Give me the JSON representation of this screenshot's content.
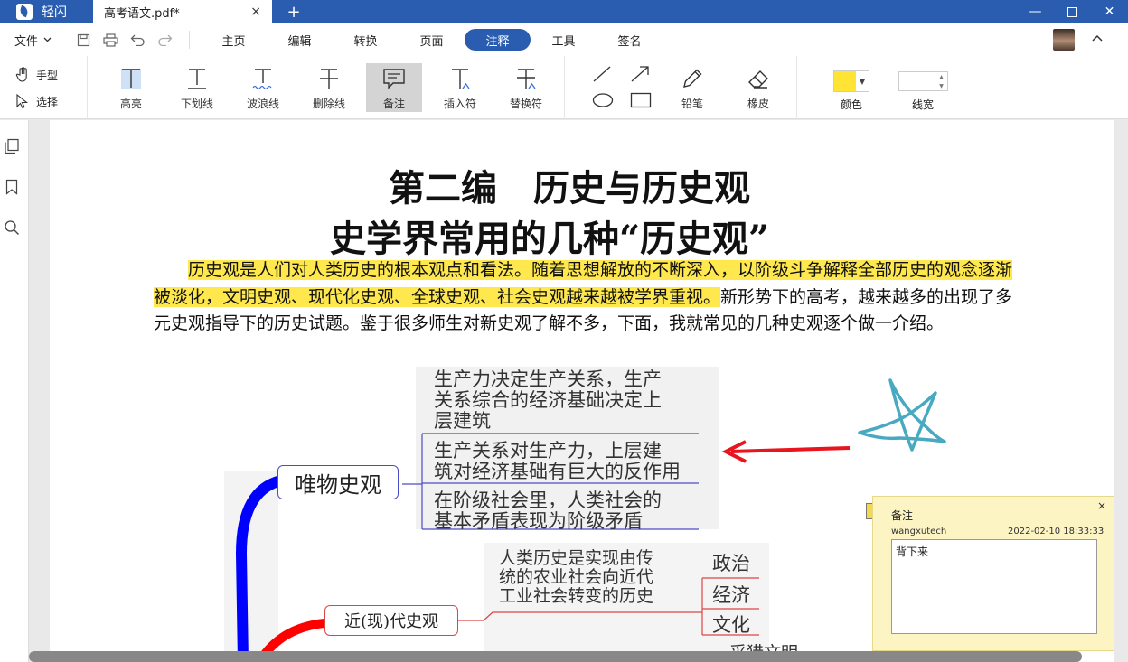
{
  "app": {
    "name": "轻闪",
    "doc_tab": "高考语文.pdf*",
    "tab_close": "×",
    "new_tab": "+"
  },
  "window": {
    "minimize": "—",
    "close": "✕"
  },
  "menu": {
    "file_label": "文件",
    "tabs": [
      {
        "label": "主页"
      },
      {
        "label": "编辑"
      },
      {
        "label": "转换"
      },
      {
        "label": "页面"
      },
      {
        "label": "注释",
        "active": true
      },
      {
        "label": "工具"
      },
      {
        "label": "签名"
      }
    ]
  },
  "toolbar": {
    "hand": "手型",
    "select": "选择",
    "tools": [
      {
        "label": "高亮"
      },
      {
        "label": "下划线"
      },
      {
        "label": "波浪线"
      },
      {
        "label": "删除线"
      },
      {
        "label": "备注",
        "selected": true
      },
      {
        "label": "插入符"
      },
      {
        "label": "替换符"
      }
    ],
    "pencil": "铅笔",
    "eraser": "橡皮",
    "color_label": "颜色",
    "color_value": "#ffe436",
    "line_width_label": "线宽"
  },
  "document": {
    "heading1": "第二编　历史与历史观",
    "heading2": "史学界常用的几种“历史观”",
    "para_highlighted": "历史观是人们对人类历史的根本观点和看法。随着思想解放的不断深入，以阶级斗争解释全部历史的观念逐渐被淡化，文明史观、现代化史观、全球史观、社会史观越来越被学界重视。",
    "para_rest": "新形势下的高考，越来越多的出现了多元史观指导下的历史试题。鉴于很多师生对新史观了解不多，下面，我就常见的几种史观逐个做一介绍。",
    "mindmap": {
      "node1": "唯物史观",
      "node2": "近(现)代史观",
      "block1": [
        "生产力决定生产关系，生产",
        "关系综合的经济基础决定上",
        "层建筑"
      ],
      "block2": [
        "生产关系对生产力，上层建",
        "筑对经济基础有巨大的反作用"
      ],
      "block3": [
        "在阶级社会里，人类社会的",
        "基本矛盾表现为阶级矛盾"
      ],
      "block4": [
        "人类历史是实现由传",
        "统的农业社会向近代",
        "工业社会转变的历史"
      ],
      "leaf1": "政治",
      "leaf2": "经济",
      "leaf3": "文化",
      "leaf4": "采猎文明"
    }
  },
  "note": {
    "title": "备注",
    "close": "×",
    "author": "wangxutech",
    "date": "2022-02-10 18:33:33",
    "content": "背下来"
  }
}
